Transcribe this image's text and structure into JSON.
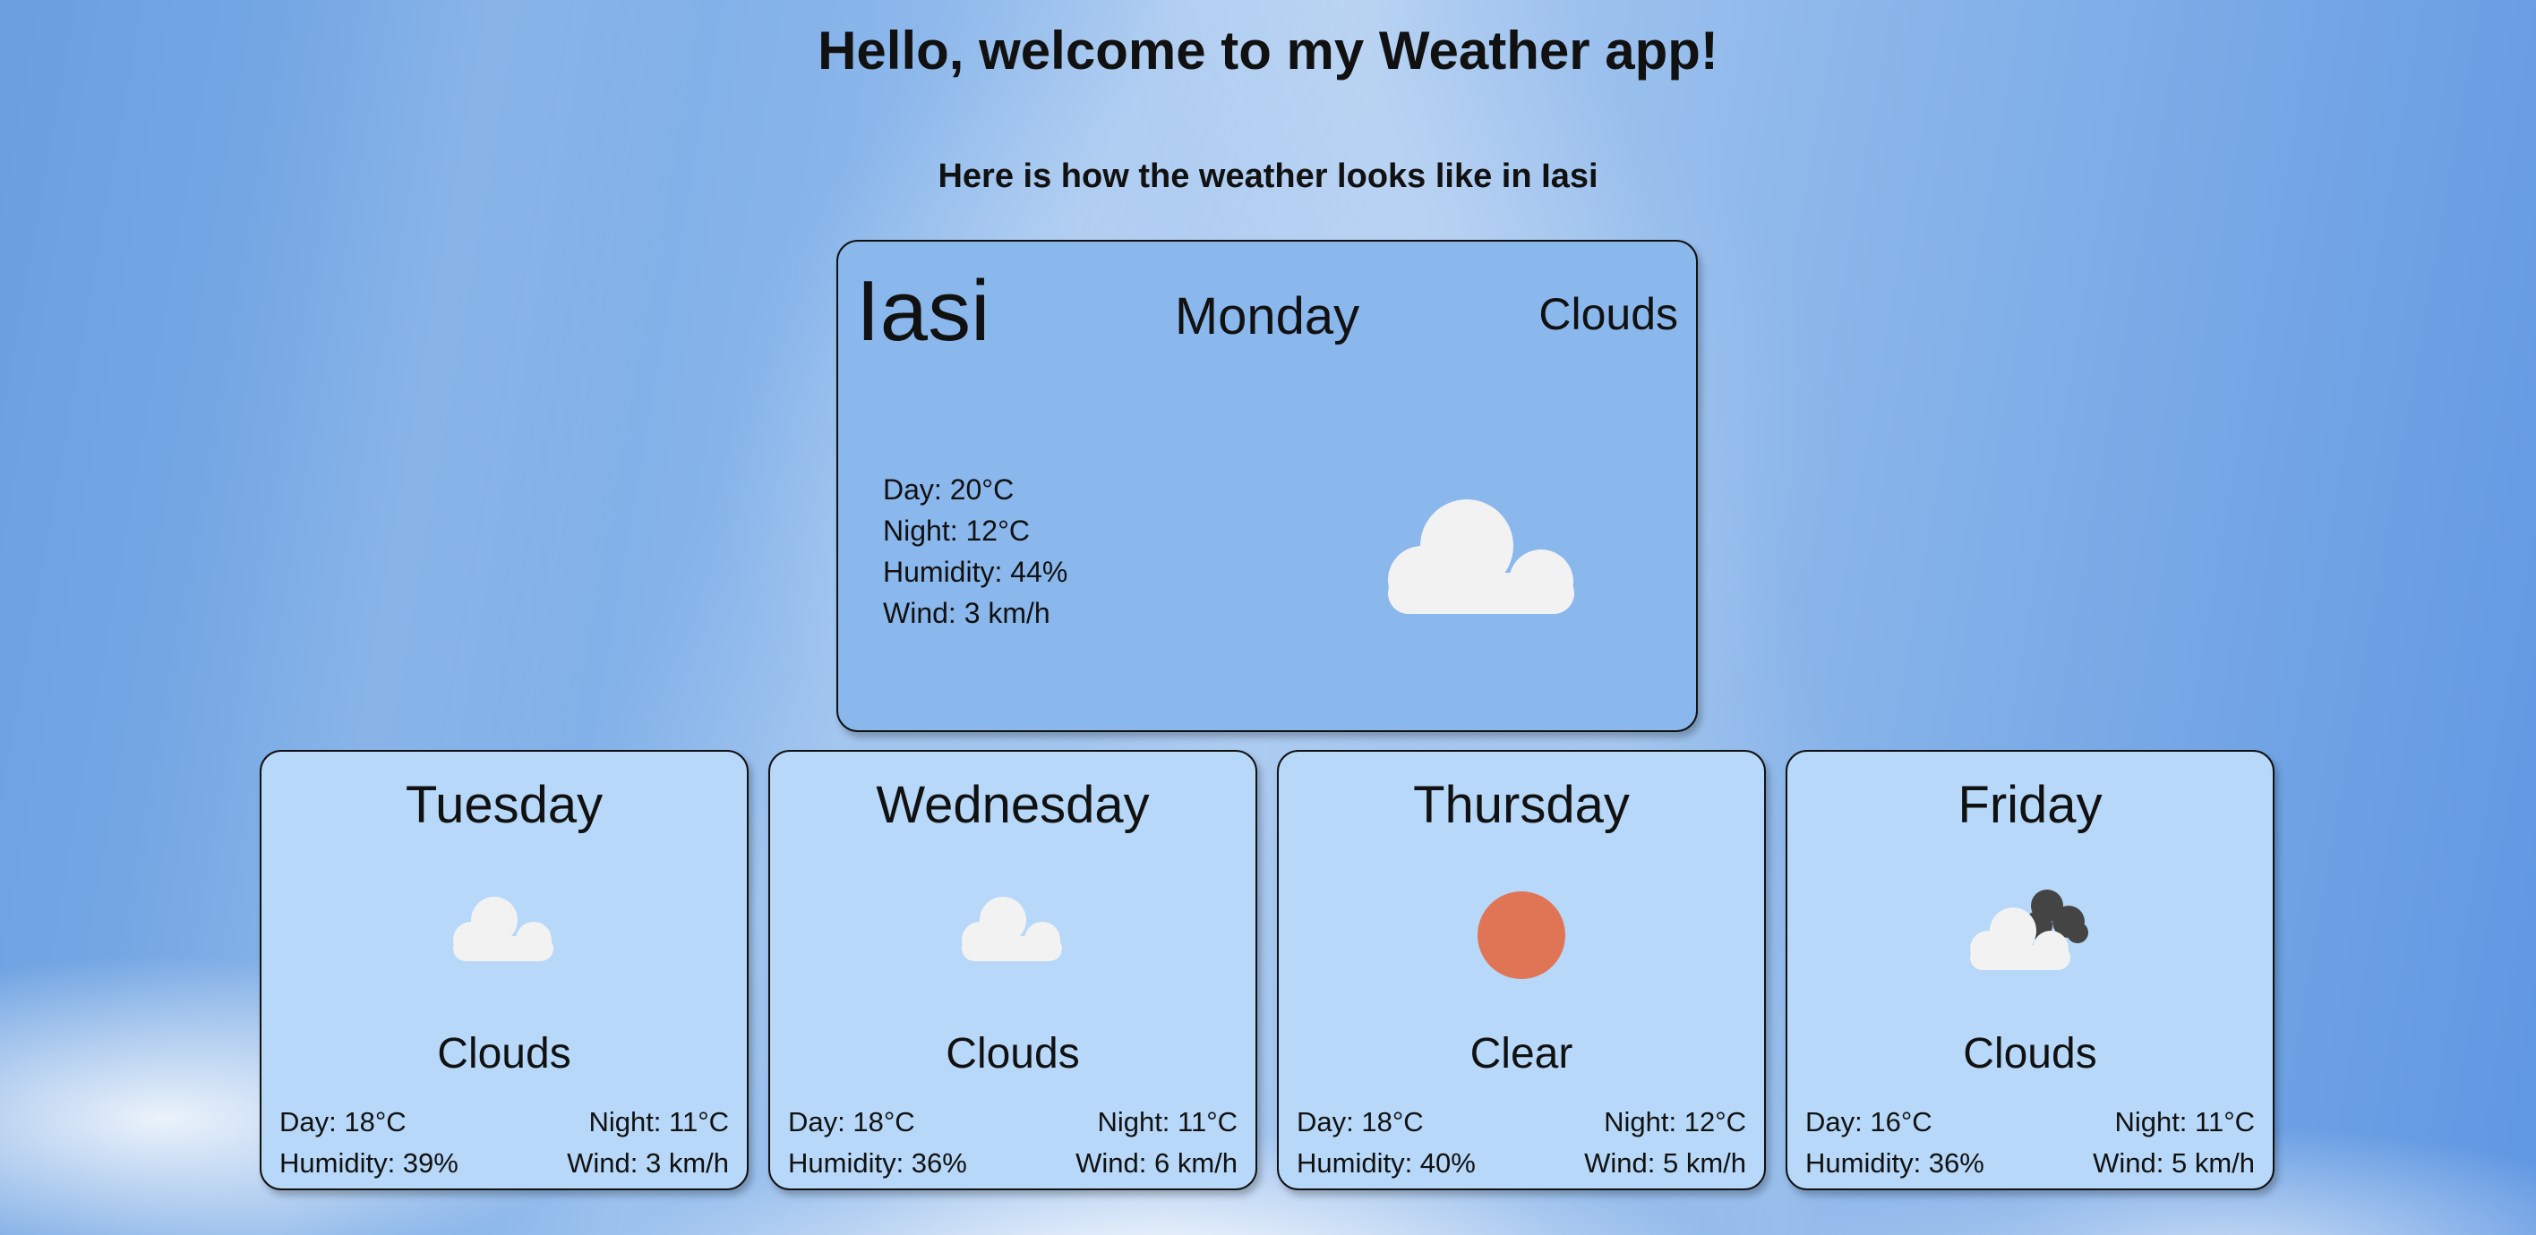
{
  "header": {
    "title": "Hello, welcome to my Weather app!",
    "subtitle": "Here is how the weather looks like in Iasi"
  },
  "today": {
    "city": "Iasi",
    "day": "Monday",
    "condition": "Clouds",
    "icon": "cloud-icon",
    "day_temp": "Day: 20°C",
    "night_temp": "Night: 12°C",
    "humidity": "Humidity: 44%",
    "wind": "Wind: 3 km/h"
  },
  "forecast": [
    {
      "day": "Tuesday",
      "condition": "Clouds",
      "icon": "cloud-icon",
      "day_temp": "Day: 18°C",
      "night_temp": "Night: 11°C",
      "humidity": "Humidity: 39%",
      "wind": "Wind: 3 km/h"
    },
    {
      "day": "Wednesday",
      "condition": "Clouds",
      "icon": "cloud-icon",
      "day_temp": "Day: 18°C",
      "night_temp": "Night: 11°C",
      "humidity": "Humidity: 36%",
      "wind": "Wind: 6 km/h"
    },
    {
      "day": "Thursday",
      "condition": "Clear",
      "icon": "sun-icon",
      "day_temp": "Day: 18°C",
      "night_temp": "Night: 12°C",
      "humidity": "Humidity: 40%",
      "wind": "Wind: 5 km/h"
    },
    {
      "day": "Friday",
      "condition": "Clouds",
      "icon": "broken-clouds-icon",
      "day_temp": "Day: 16°C",
      "night_temp": "Night: 11°C",
      "humidity": "Humidity: 36%",
      "wind": "Wind: 5 km/h"
    }
  ],
  "colors": {
    "main_card": "#8ab7ec",
    "forecast_card": "#b7d8f8",
    "sun": "#e07555",
    "cloud_light": "#f2f2f2",
    "cloud_dark": "#444444"
  }
}
